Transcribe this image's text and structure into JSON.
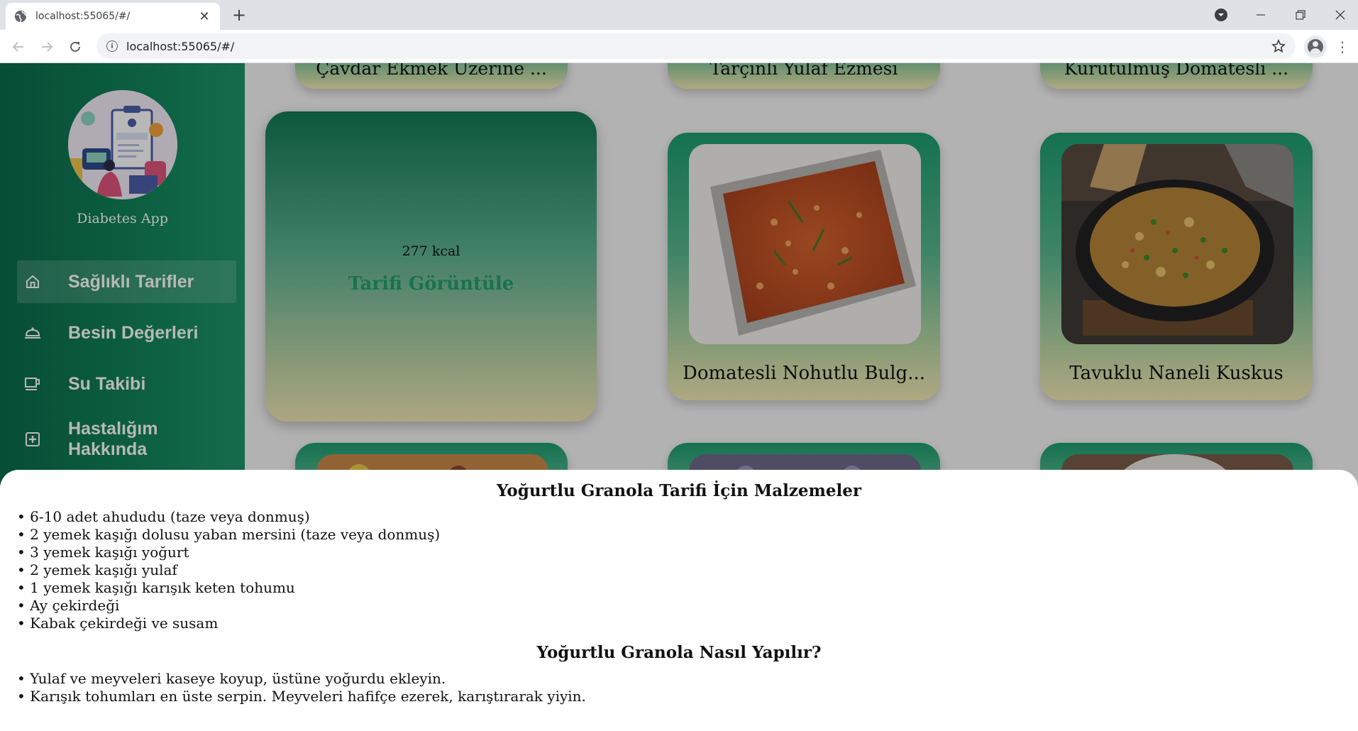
{
  "browser": {
    "tab_title": "localhost:55065/#/",
    "url": "localhost:55065/#/",
    "new_tab_symbol": "+",
    "close_symbol": "✕"
  },
  "sidebar": {
    "app_name": "Diabetes App",
    "items": [
      {
        "label": "Sağlıklı Tarifler",
        "icon": "home-icon",
        "active": true
      },
      {
        "label": "Besin Değerleri",
        "icon": "food-tray-icon",
        "active": false
      },
      {
        "label": "Su Takibi",
        "icon": "cup-icon",
        "active": false
      },
      {
        "label": "Hastalığım Hakkında",
        "icon": "medical-plus-icon",
        "active": false
      }
    ]
  },
  "recipes": {
    "top_row": [
      "Çavdar Ekmek Üzerine ...",
      "Tarçınlı Yulaf Ezmesi",
      "Kurutulmuş Domatesli ..."
    ],
    "hover_card": {
      "kcal": "277 kcal",
      "link": "Tarifi Görüntüle"
    },
    "cards": [
      {
        "title": "Domatesli Nohutlu Bulg..."
      },
      {
        "title": "Tavuklu Naneli Kuskus"
      }
    ]
  },
  "sheet": {
    "ingredients_title": "Yoğurtlu Granola Tarifi İçin Malzemeler",
    "ingredients": [
      "6-10 adet ahududu (taze veya donmuş)",
      "2 yemek kaşığı dolusu yaban mersini (taze veya donmuş)",
      "3 yemek kaşığı yoğurt",
      "2 yemek kaşığı yulaf",
      "1 yemek kaşığı karışık keten tohumu",
      "Ay çekirdeği",
      "Kabak çekirdeği ve susam"
    ],
    "steps_title": "Yoğurtlu Granola Nasıl Yapılır?",
    "steps": [
      "Yulaf ve meyveleri kaseye koyup, üstüne yoğurdu ekleyin.",
      "Karışık tohumları en üste serpin. Meyveleri hafifçe ezerek, karıştırarak yiyin."
    ]
  },
  "colors": {
    "sidebar": "#0a6b4a",
    "accent": "#22a06b",
    "card_bottom": "#f3eab3"
  }
}
